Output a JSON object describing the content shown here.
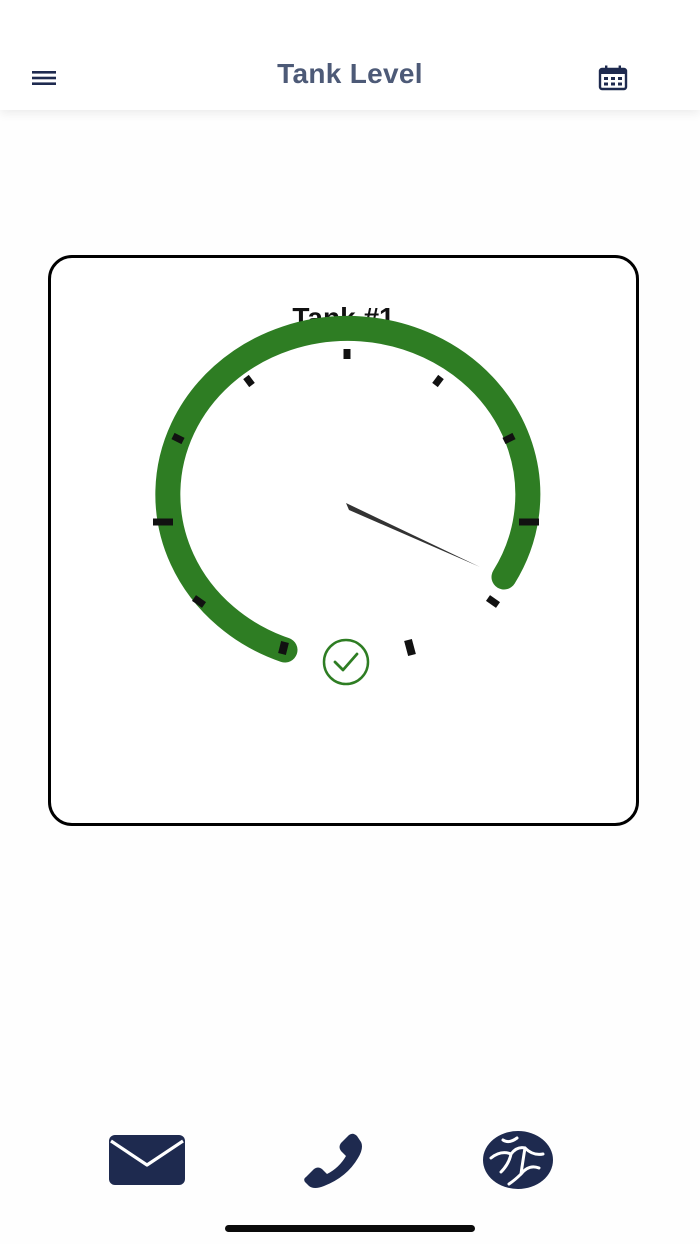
{
  "header": {
    "title": "Tank Level",
    "menu_icon": "hamburger-menu-icon",
    "calendar_icon": "calendar-icon",
    "title_color": "#4d5a77"
  },
  "tank": {
    "name": "Tank #1",
    "status_icon": "check-circle-icon",
    "gauge_color": "#2e7d23",
    "needle_color": "#333333",
    "status": "ok"
  },
  "bottom_nav": {
    "items": [
      {
        "name": "email",
        "icon": "envelope-icon"
      },
      {
        "name": "call",
        "icon": "phone-icon"
      },
      {
        "name": "web",
        "icon": "globe-icon"
      }
    ],
    "icon_color": "#1e2a4f"
  }
}
